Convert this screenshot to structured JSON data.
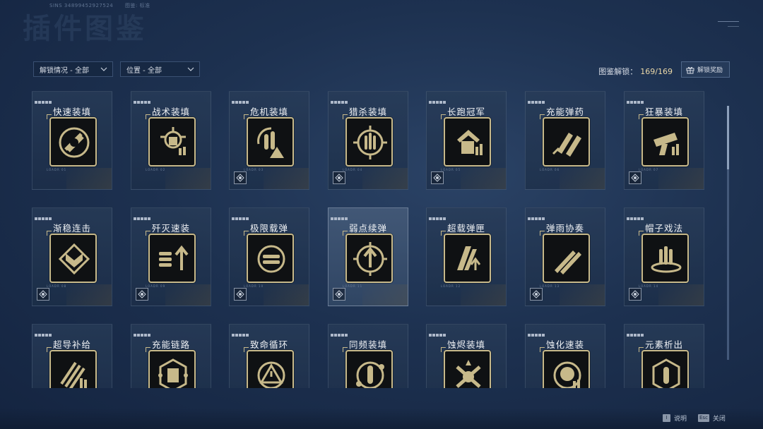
{
  "top_info": {
    "sins": "SINS 34899452927524",
    "meta": "图鉴: 标准"
  },
  "page": {
    "title_ghost": "插件图鉴"
  },
  "filters": [
    {
      "label": "解锁情况 - 全部"
    },
    {
      "label": "位置 - 全部"
    }
  ],
  "unlock": {
    "label": "图鉴解锁：",
    "value": "169/169"
  },
  "reward_button": {
    "label": "解锁奖励"
  },
  "cards": [
    {
      "name": "快速装填",
      "icon": "fast-reload-icon",
      "badge": false,
      "small": "LOADR 01"
    },
    {
      "name": "战术装填",
      "icon": "tactical-reload-icon",
      "badge": false,
      "small": "LOADR 02"
    },
    {
      "name": "危机装填",
      "icon": "crisis-reload-icon",
      "badge": true,
      "small": "LOADR 03"
    },
    {
      "name": "猎杀装填",
      "icon": "hunt-reload-icon",
      "badge": true,
      "small": "LOADR 04"
    },
    {
      "name": "长跑冠军",
      "icon": "marathon-icon",
      "badge": true,
      "small": "LOADR 05"
    },
    {
      "name": "充能弹药",
      "icon": "charged-ammo-icon",
      "badge": false,
      "small": "LOADR 06"
    },
    {
      "name": "狂暴装填",
      "icon": "berserk-reload-icon",
      "badge": true,
      "small": "LOADR 07"
    },
    {
      "name": "渐稳连击",
      "icon": "steady-combo-icon",
      "badge": true,
      "small": "LOADR 08"
    },
    {
      "name": "歼灭速装",
      "icon": "annihilate-reload-icon",
      "badge": true,
      "small": "LOADR 09"
    },
    {
      "name": "极限载弹",
      "icon": "max-ammo-icon",
      "badge": true,
      "small": "LOADR 10"
    },
    {
      "name": "弱点续弹",
      "icon": "weakpoint-refill-icon",
      "badge": true,
      "small": "LOADR 11"
    },
    {
      "name": "超载弹匣",
      "icon": "overload-mag-icon",
      "badge": false,
      "small": "LOADR 12"
    },
    {
      "name": "弹雨协奏",
      "icon": "bullet-rain-icon",
      "badge": true,
      "small": "LOADR 13"
    },
    {
      "name": "帽子戏法",
      "icon": "hat-trick-icon",
      "badge": true,
      "small": "LOADR 14"
    },
    {
      "name": "超导补给",
      "icon": "superconduct-supply-icon",
      "badge": false,
      "small": ""
    },
    {
      "name": "充能链路",
      "icon": "charge-link-icon",
      "badge": false,
      "small": ""
    },
    {
      "name": "致命循环",
      "icon": "fatal-loop-icon",
      "badge": false,
      "small": ""
    },
    {
      "name": "同频装填",
      "icon": "sync-reload-icon",
      "badge": false,
      "small": ""
    },
    {
      "name": "蚀烬装填",
      "icon": "corrode-ember-icon",
      "badge": false,
      "small": ""
    },
    {
      "name": "蚀化速装",
      "icon": "corrode-reload-icon",
      "badge": false,
      "small": ""
    },
    {
      "name": "元素析出",
      "icon": "element-extract-icon",
      "badge": false,
      "small": ""
    }
  ],
  "selected_index": 10,
  "hints": [
    {
      "key": "I",
      "label": "说明"
    },
    {
      "key": "Esc",
      "label": "关闭"
    }
  ],
  "colors": {
    "gold": "#c7b98a",
    "bg": "#1d3150",
    "accent": "#ecd9a8"
  }
}
